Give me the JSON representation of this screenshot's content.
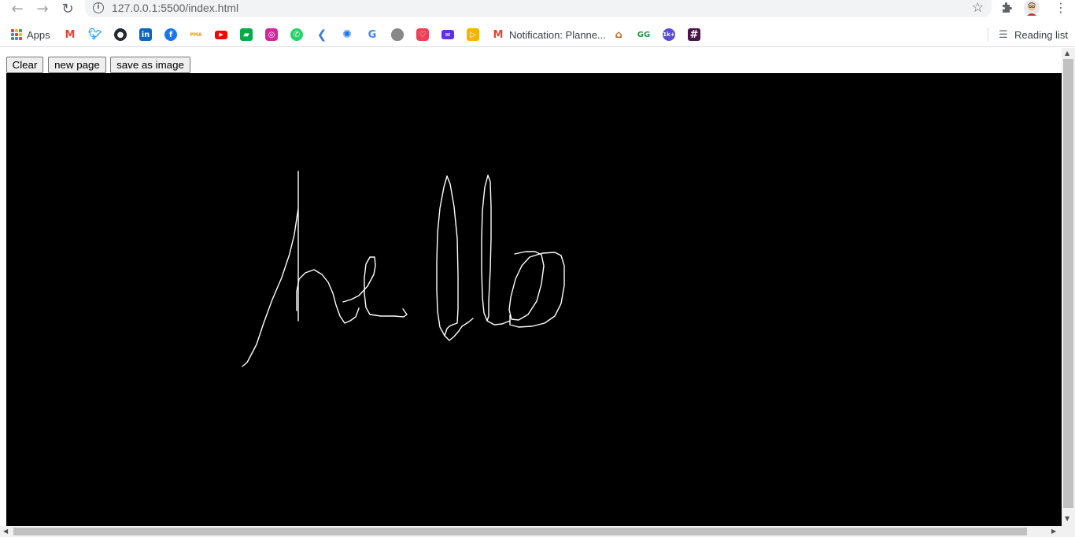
{
  "browser": {
    "url": "127.0.0.1:5500/index.html",
    "reading_list_label": "Reading list"
  },
  "bookmarks": {
    "apps_label": "Apps",
    "items": [
      {
        "name": "gmail",
        "label": ""
      },
      {
        "name": "twitter",
        "label": ""
      },
      {
        "name": "github",
        "label": ""
      },
      {
        "name": "linkedin",
        "label": ""
      },
      {
        "name": "facebook",
        "label": ""
      },
      {
        "name": "pma",
        "label": "PMA"
      },
      {
        "name": "youtube",
        "label": ""
      },
      {
        "name": "google-meet",
        "label": ""
      },
      {
        "name": "instagram",
        "label": ""
      },
      {
        "name": "whatsapp",
        "label": ""
      },
      {
        "name": "kite",
        "label": ""
      },
      {
        "name": "bulb",
        "label": ""
      },
      {
        "name": "google",
        "label": ""
      },
      {
        "name": "apple",
        "label": ""
      },
      {
        "name": "pocket",
        "label": ""
      },
      {
        "name": "mail",
        "label": ""
      },
      {
        "name": "slides",
        "label": ""
      },
      {
        "name": "gmail-notification",
        "label": "Notification: Planne..."
      },
      {
        "name": "temple",
        "label": ""
      },
      {
        "name": "geeksforgeeks",
        "label": "GG"
      },
      {
        "name": "leetcode",
        "label": "1k+"
      },
      {
        "name": "slack",
        "label": ""
      }
    ]
  },
  "page": {
    "buttons": {
      "clear": "Clear",
      "new_page": "new page",
      "save_image": "save as image"
    },
    "canvas": {
      "background": "#000000",
      "stroke_color": "#ffffff",
      "handwritten_text": "hello"
    }
  }
}
